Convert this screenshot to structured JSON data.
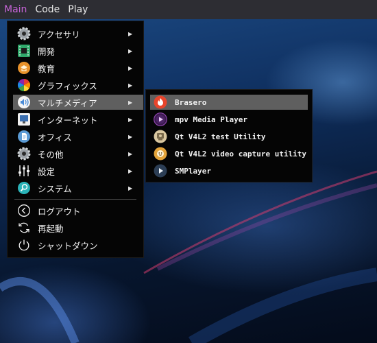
{
  "topbar": {
    "items": [
      "Main",
      "Code",
      "Play"
    ]
  },
  "menu": {
    "items": [
      {
        "label": "アクセサリ",
        "icon": "gear-icon",
        "submenu": true
      },
      {
        "label": "開発",
        "icon": "circuit-board-icon",
        "submenu": true
      },
      {
        "label": "教育",
        "icon": "education-icon",
        "submenu": true
      },
      {
        "label": "グラフィックス",
        "icon": "color-wheel-icon",
        "submenu": true
      },
      {
        "label": "マルチメディア",
        "icon": "speaker-icon",
        "submenu": true,
        "highlighted": true
      },
      {
        "label": "インターネット",
        "icon": "network-icon",
        "submenu": true
      },
      {
        "label": "オフィス",
        "icon": "document-icon",
        "submenu": true
      },
      {
        "label": "その他",
        "icon": "gear-icon",
        "submenu": true
      },
      {
        "label": "設定",
        "icon": "sliders-icon",
        "submenu": true
      },
      {
        "label": "システム",
        "icon": "magnifier-icon",
        "submenu": true
      }
    ],
    "session": [
      {
        "label": "ログアウト",
        "icon": "logout-icon"
      },
      {
        "label": "再起動",
        "icon": "restart-icon"
      },
      {
        "label": "シャットダウン",
        "icon": "power-icon"
      }
    ]
  },
  "submenu": {
    "items": [
      {
        "label": "Brasero",
        "icon": "brasero-flame-icon",
        "highlighted": true
      },
      {
        "label": "mpv Media Player",
        "icon": "mpv-play-icon"
      },
      {
        "label": "Qt V4L2 test Utility",
        "icon": "webcam-icon"
      },
      {
        "label": "Qt V4L2 video capture utility",
        "icon": "webcam-face-icon"
      },
      {
        "label": "SMPlayer",
        "icon": "smplayer-icon"
      }
    ]
  },
  "colors": {
    "accent": "#c764d8",
    "highlight": "#5f5f5f",
    "menu_bg": "#050505",
    "topbar_bg": "#2d2d33"
  }
}
